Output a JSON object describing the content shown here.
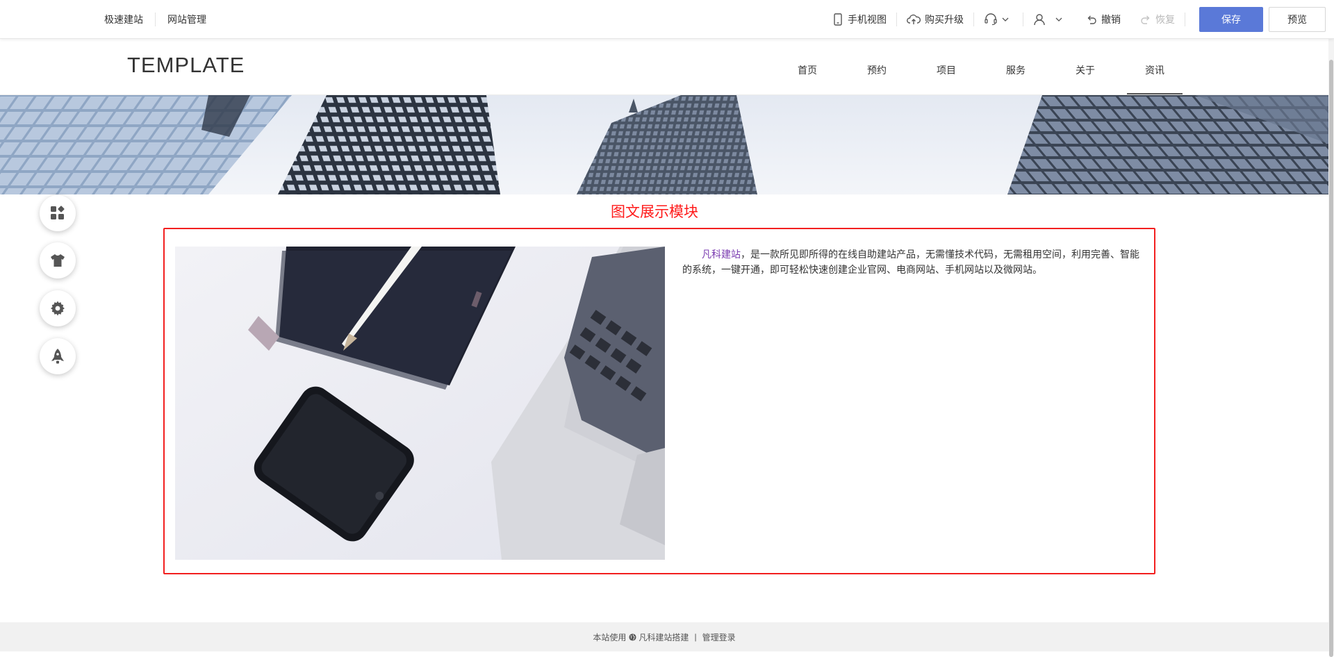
{
  "toolbar": {
    "left_links": [
      "极速建站",
      "网站管理"
    ],
    "mobile_view": "手机视图",
    "upgrade": "购买升级",
    "undo": "撤销",
    "redo": "恢复",
    "save": "保存",
    "preview": "预览",
    "icons": {
      "mobile": "phone-icon",
      "upgrade": "cloud-upload-icon",
      "support": "headset-icon",
      "user": "user-icon",
      "undo": "undo-icon",
      "redo": "redo-icon"
    },
    "accent_color": "#5a79d8"
  },
  "site": {
    "logo": "TEMPLATE",
    "nav": [
      {
        "label": "首页"
      },
      {
        "label": "预约"
      },
      {
        "label": "项目"
      },
      {
        "label": "服务"
      },
      {
        "label": "关于"
      },
      {
        "label": "资讯",
        "active": true
      }
    ]
  },
  "float_tools": [
    "apps-icon",
    "shirt-icon",
    "gear-icon",
    "rocket-icon"
  ],
  "module": {
    "title": "图文展示模块",
    "highlight_color": "#f21f1f",
    "text_link": "凡科建站",
    "text_body": "，是一款所见即所得的在线自助建站产品，无需懂技术代码，无需租用空间，利用完善、智能的系统，一键开通，即可轻松快速创建企业官网、电商网站、手机网站以及微网站。"
  },
  "footer": {
    "prefix": "本站使用",
    "brand": "凡科建站搭建",
    "separator": "|",
    "admin_login": "管理登录"
  }
}
